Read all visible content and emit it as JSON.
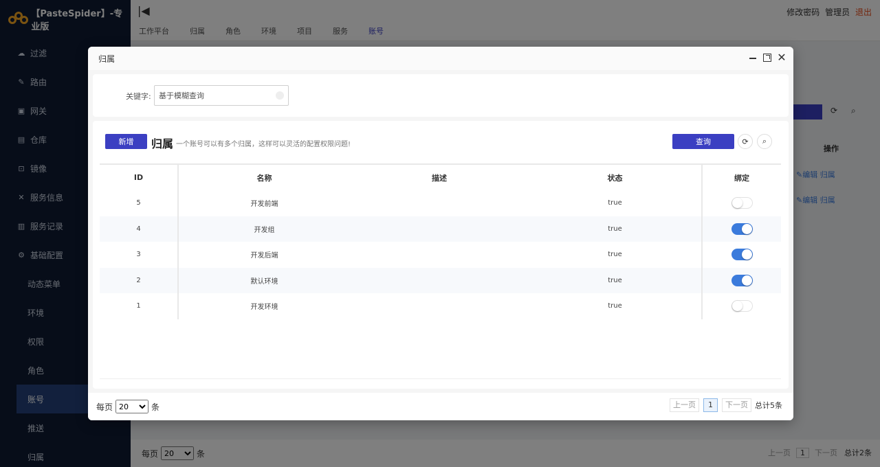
{
  "app": {
    "logo_text": "【PasteSpider】-专业版"
  },
  "sidebar": {
    "items": [
      {
        "label": "过滤",
        "icon": "cloud-icon"
      },
      {
        "label": "路由",
        "icon": "link-icon"
      },
      {
        "label": "网关",
        "icon": "gateway-icon"
      },
      {
        "label": "仓库",
        "icon": "repository-icon"
      },
      {
        "label": "镜像",
        "icon": "image-icon"
      },
      {
        "label": "服务信息",
        "icon": "tools-icon"
      },
      {
        "label": "服务记录",
        "icon": "record-icon"
      },
      {
        "label": "基础配置",
        "icon": "gear-icon"
      }
    ],
    "sub_items": [
      {
        "label": "动态菜单"
      },
      {
        "label": "环境"
      },
      {
        "label": "权限"
      },
      {
        "label": "角色"
      },
      {
        "label": "账号",
        "active": true
      },
      {
        "label": "推送"
      },
      {
        "label": "归属"
      }
    ]
  },
  "topbar": {
    "change_password": "修改密码",
    "user": "管理员",
    "logout": "退出",
    "tabs": [
      "工作平台",
      "归属",
      "角色",
      "环境",
      "项目",
      "服务",
      "账号"
    ],
    "active_tab": "账号"
  },
  "background": {
    "op_header": "操作",
    "row_links": [
      "✎编辑 归属",
      "✎编辑 归属"
    ],
    "per_page_label": "每页",
    "per_page_value": "20",
    "per_page_unit": "条",
    "prev": "上一页",
    "page": "1",
    "next": "下一页",
    "total": "总计2条"
  },
  "modal": {
    "title": "归属",
    "search": {
      "label": "关键字:",
      "placeholder": "基于模糊查询"
    },
    "list": {
      "add_label": "新增",
      "title": "归属",
      "description": "一个账号可以有多个归属，这样可以灵活的配置权限问题!",
      "query_label": "查询"
    },
    "table": {
      "headers": {
        "id": "ID",
        "name": "名称",
        "desc": "描述",
        "status": "状态",
        "bind": "绑定"
      },
      "rows": [
        {
          "id": "5",
          "name": "开发前端",
          "desc": "",
          "status": "true",
          "bound": false
        },
        {
          "id": "4",
          "name": "开发组",
          "desc": "",
          "status": "true",
          "bound": true
        },
        {
          "id": "3",
          "name": "开发后端",
          "desc": "",
          "status": "true",
          "bound": true
        },
        {
          "id": "2",
          "name": "默认环境",
          "desc": "",
          "status": "true",
          "bound": true
        },
        {
          "id": "1",
          "name": "开发环境",
          "desc": "",
          "status": "true",
          "bound": false
        }
      ]
    },
    "footer": {
      "per_page_label": "每页",
      "per_page_value": "20",
      "per_page_options": [
        "20"
      ],
      "per_page_unit": "条",
      "prev": "上一页",
      "page": "1",
      "next": "下一页",
      "total": "总计5条"
    }
  },
  "colors": {
    "primary": "#3b3fc2",
    "toggle_on": "#3b7bdc",
    "sidebar_bg": "#0e1b33"
  }
}
